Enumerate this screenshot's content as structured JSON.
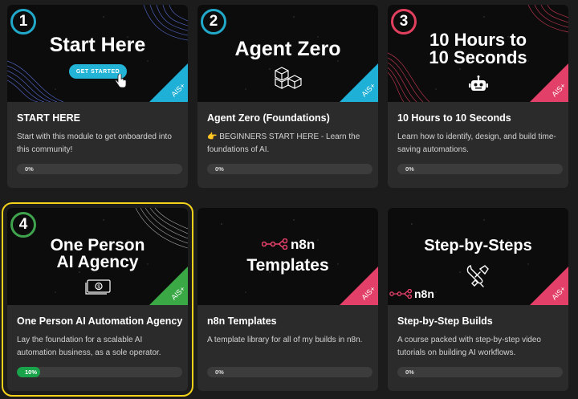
{
  "cards": [
    {
      "number": "1",
      "hero_title": "Start Here",
      "hero_button": "GET STARTED",
      "badge": "AIS+",
      "title": "START HERE",
      "description": "Start with this module to get onboarded into this community!",
      "progress_label": "0%",
      "progress": 0,
      "accent": "#22a9c9",
      "ribbon": "#1eb0d6",
      "hero_icon": "hand-cursor-icon"
    },
    {
      "number": "2",
      "hero_title": "Agent Zero",
      "badge": "AIS+",
      "title": "Agent Zero (Foundations)",
      "description": "👉 BEGINNERS START HERE - Learn the foundations of AI.",
      "progress_label": "0%",
      "progress": 0,
      "accent": "#22a9c9",
      "ribbon": "#1eb0d6",
      "hero_icon": "cubes-icon"
    },
    {
      "number": "3",
      "hero_title": "10 Hours to\n10 Seconds",
      "badge": "AIS+",
      "title": "10 Hours to 10 Seconds",
      "description": "Learn how to identify, design, and build time-saving automations.",
      "progress_label": "0%",
      "progress": 0,
      "accent": "#e0405e",
      "ribbon": "#e24068",
      "hero_icon": "robot-icon"
    },
    {
      "number": "4",
      "hero_title": "One Person\nAI Agency",
      "badge": "AIS+",
      "title": "One Person AI Automation Agency",
      "description": "Lay the foundation for a scalable AI automation business, as a sole operator.",
      "progress_label": "10%",
      "progress": 10,
      "accent": "#3fa34d",
      "ribbon": "#3aa845",
      "hero_icon": "money-icon"
    },
    {
      "hero_brand": "n8n",
      "hero_title": "Templates",
      "badge": "AIS+",
      "title": "n8n Templates",
      "description": "A template library for all of my builds in n8n.",
      "progress_label": "0%",
      "progress": 0,
      "ribbon": "#e24068",
      "hero_icon": "n8n-logo-icon"
    },
    {
      "hero_title": "Step-by-Steps",
      "hero_brand": "n8n",
      "badge": "AIS+",
      "title": "Step-by-Step Builds",
      "description": "A course packed with step-by-step video tutorials on building AI workflows.",
      "progress_label": "0%",
      "progress": 0,
      "ribbon": "#e24068",
      "hero_icon": "wrench-icon"
    }
  ]
}
